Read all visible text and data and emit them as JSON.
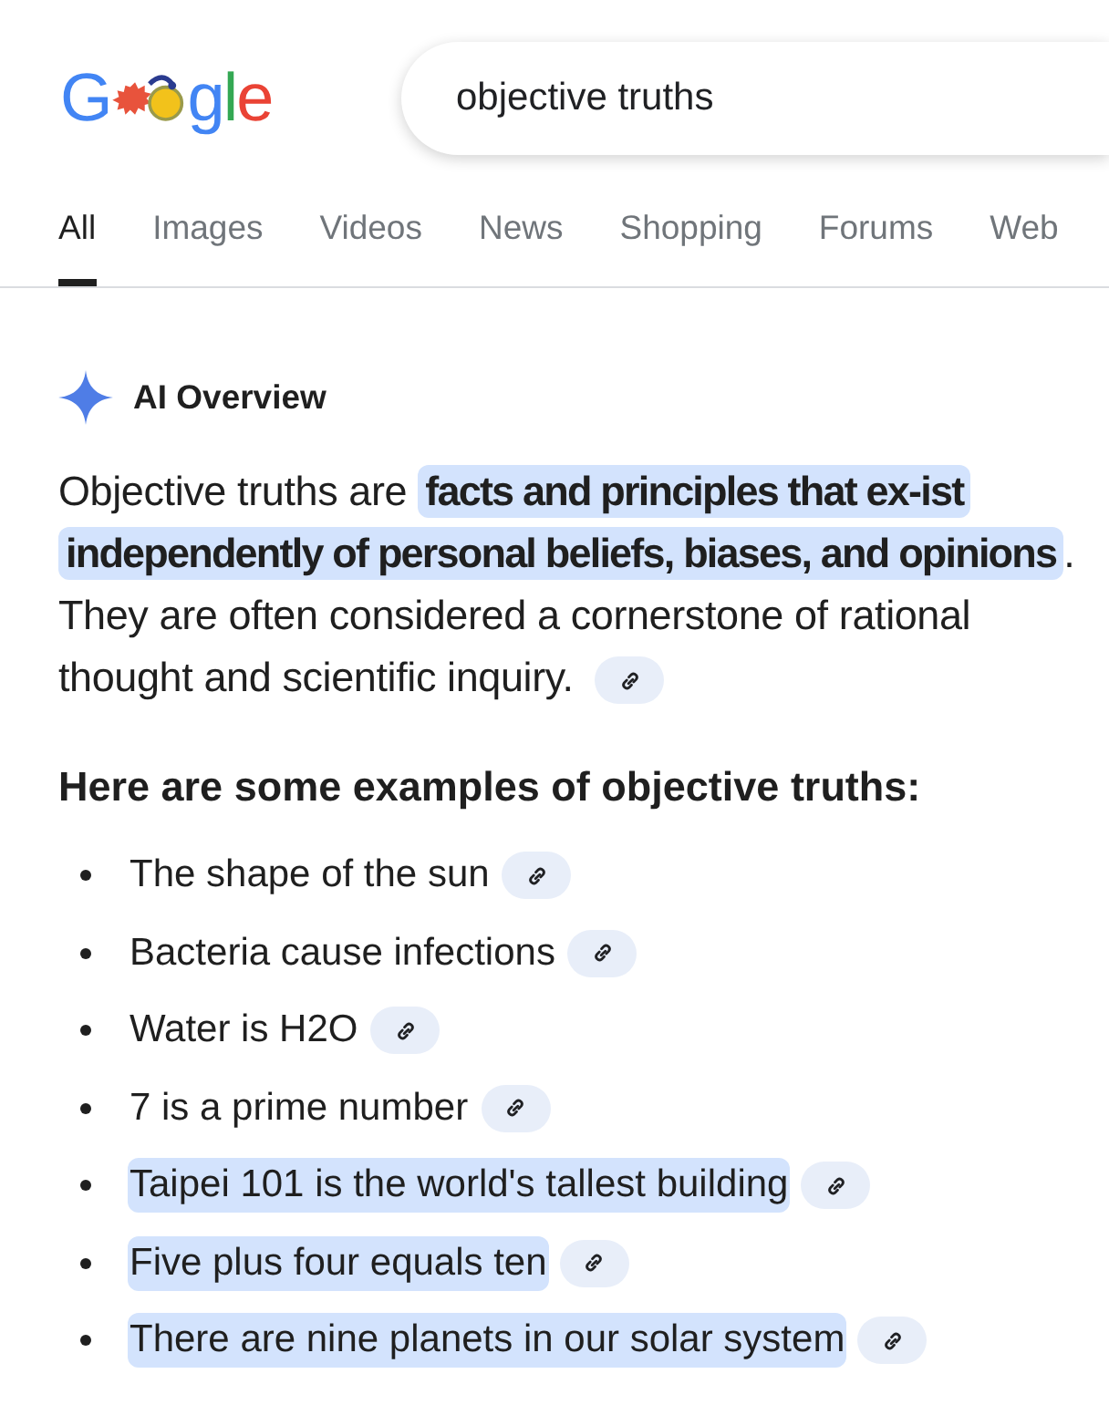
{
  "logo": {
    "start": "G",
    "end": "gle"
  },
  "search": {
    "value": "objective truths"
  },
  "tabs": [
    {
      "label": "All",
      "selected": true
    },
    {
      "label": "Images",
      "selected": false
    },
    {
      "label": "Videos",
      "selected": false
    },
    {
      "label": "News",
      "selected": false
    },
    {
      "label": "Shopping",
      "selected": false
    },
    {
      "label": "Forums",
      "selected": false
    },
    {
      "label": "Web",
      "selected": false
    }
  ],
  "ai_overview": {
    "title": "AI Overview",
    "intro": [
      {
        "text": "Objective truths are ",
        "highlighted": false
      },
      {
        "text": "facts and principles that ex-ist independently of personal beliefs, biases, and opinions",
        "highlighted": true
      },
      {
        "text": ". They are often considered a cornerstone of rational thought and scientific inquiry.",
        "highlighted": false
      }
    ],
    "heading": "Here are some examples of objective truths:",
    "examples": [
      {
        "text": "The shape of the sun",
        "highlighted": false
      },
      {
        "text": "Bacteria cause infections",
        "highlighted": false
      },
      {
        "text": "Water is H2O",
        "highlighted": false
      },
      {
        "text": "7 is a prime number",
        "highlighted": false
      },
      {
        "text": "Taipei 101 is the world's tallest building",
        "highlighted": true
      },
      {
        "text": "Five plus four equals ten",
        "highlighted": true
      },
      {
        "text": "There are nine planets in our solar system",
        "highlighted": true
      }
    ]
  }
}
